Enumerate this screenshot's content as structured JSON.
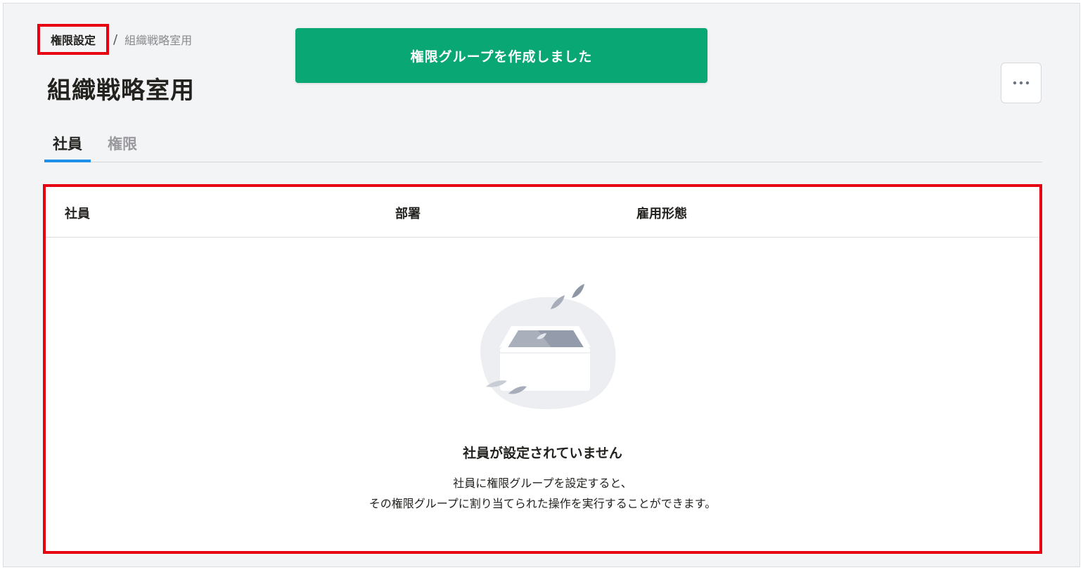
{
  "breadcrumb": {
    "root_label": "権限設定",
    "separator": "/",
    "current_label": "組織戦略室用"
  },
  "page": {
    "title": "組織戦略室用"
  },
  "toast": {
    "message": "権限グループを作成しました",
    "color": "#09a774"
  },
  "more_button": {
    "icon": "ellipsis-icon"
  },
  "tabs": [
    {
      "label": "社員",
      "active": true
    },
    {
      "label": "権限",
      "active": false
    }
  ],
  "table": {
    "columns": [
      "社員",
      "部署",
      "雇用形態"
    ],
    "rows": []
  },
  "empty_state": {
    "icon": "empty-inbox-illustration",
    "title": "社員が設定されていません",
    "description_line1": "社員に権限グループを設定すると、",
    "description_line2": "その権限グループに割り当てられた操作を実行することができます。"
  },
  "colors": {
    "highlight": "#e60012",
    "tab_active_underline": "#1f8fe8",
    "background": "#f3f4f6"
  }
}
